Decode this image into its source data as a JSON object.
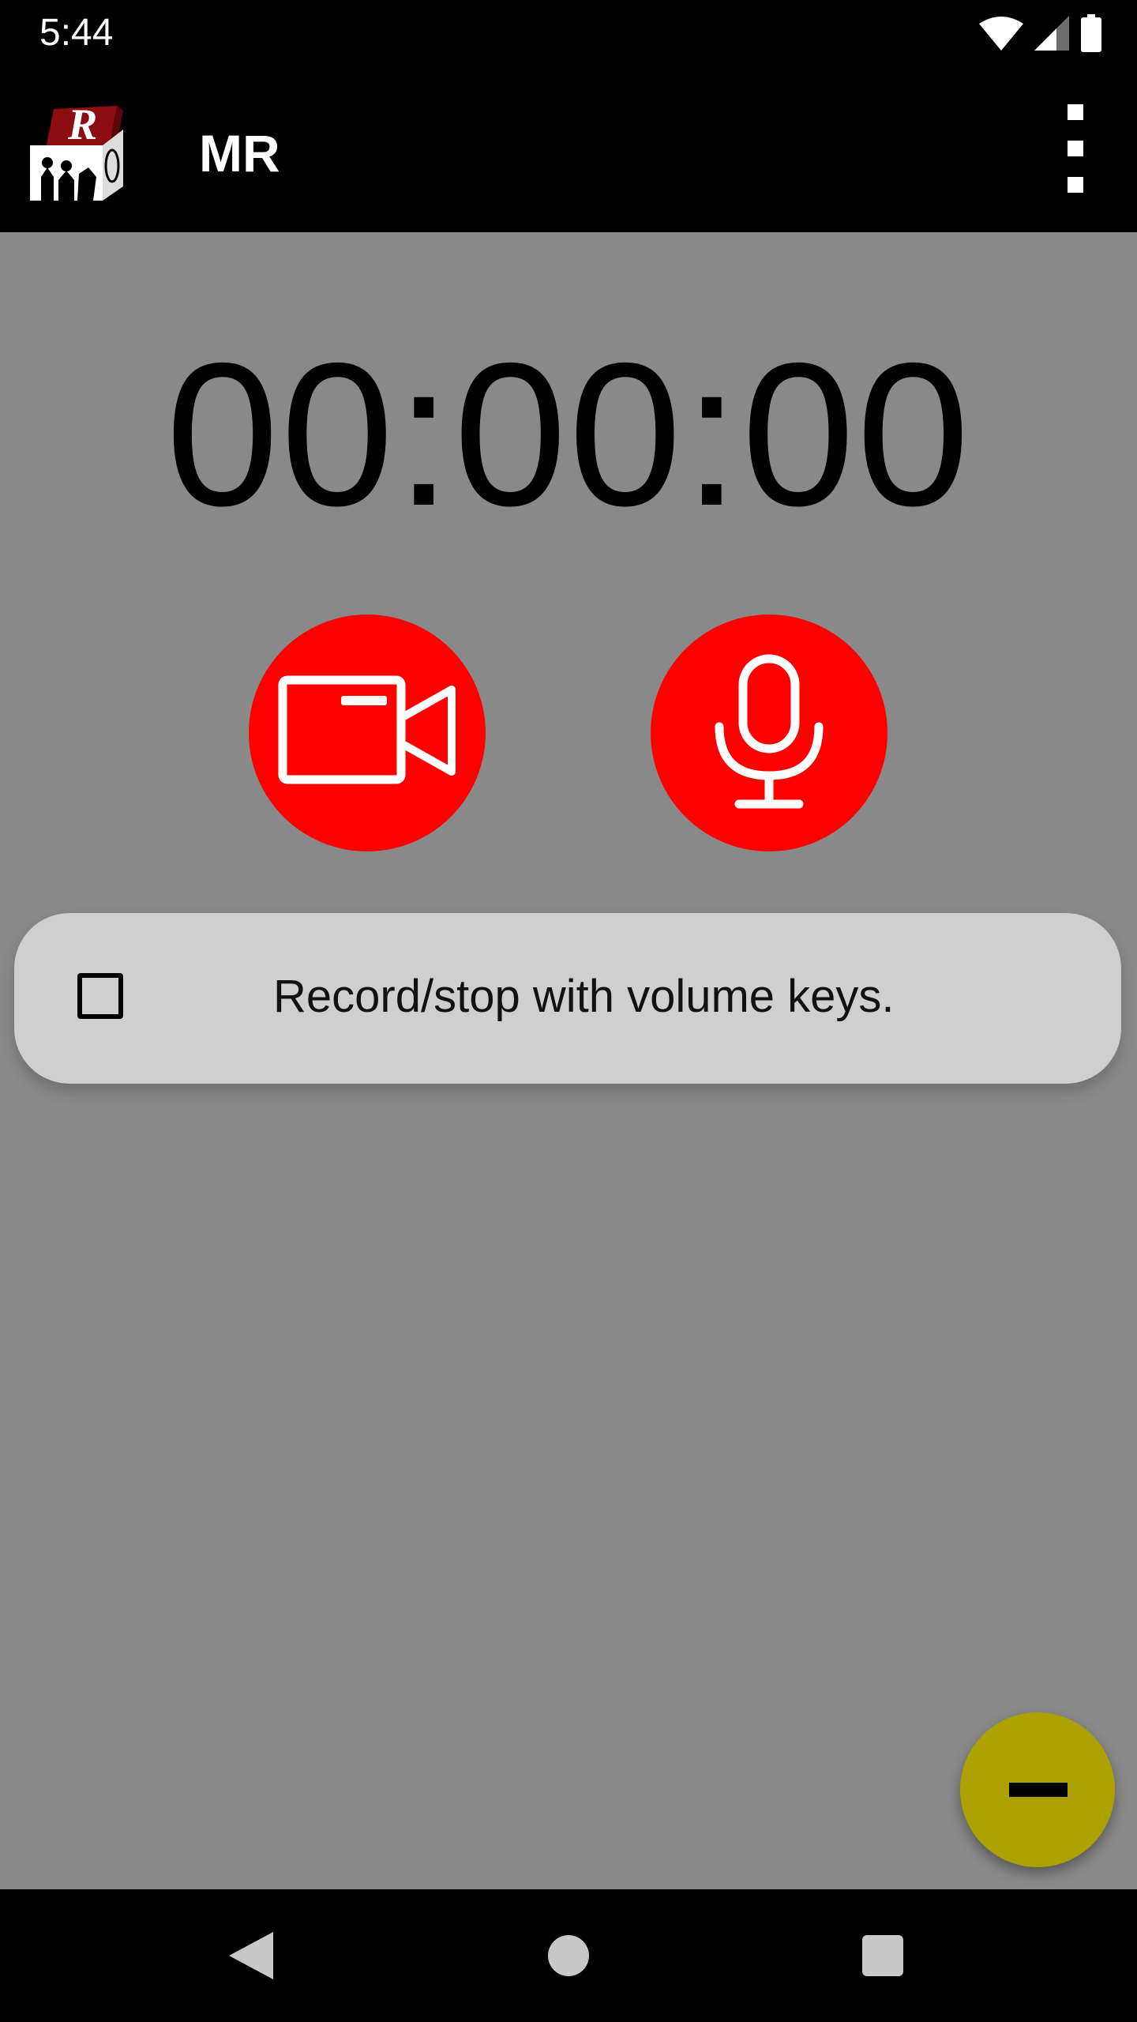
{
  "status_bar": {
    "time": "5:44",
    "icons": [
      "wifi-icon",
      "signal-icon",
      "battery-icon"
    ]
  },
  "app_bar": {
    "title": "MR",
    "logo": "mr-app-logo",
    "menu_icon": "more-vert-icon"
  },
  "timer": {
    "value": "00:00:00"
  },
  "record_buttons": {
    "video_icon": "videocam-icon",
    "audio_icon": "mic-icon",
    "color": "#ff0000"
  },
  "volume_option": {
    "label": "Record/stop with volume keys.",
    "checked": false
  },
  "fab": {
    "icon": "minus-icon",
    "color": "#aca100"
  },
  "nav_bar": {
    "icons": [
      "back-icon",
      "home-icon",
      "recents-icon"
    ]
  },
  "colors": {
    "background": "#898989",
    "bars": "#000000",
    "card": "#cfcfcf"
  }
}
